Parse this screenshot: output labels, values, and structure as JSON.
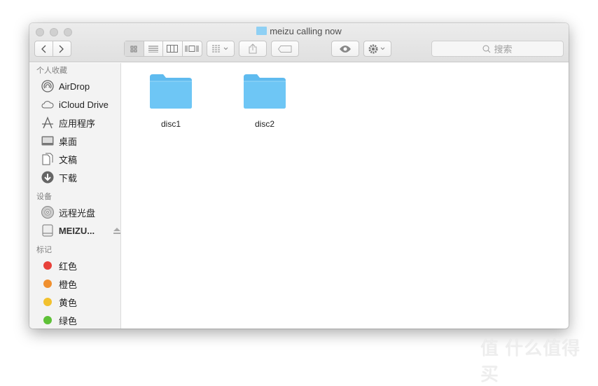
{
  "window": {
    "title": "meizu calling now"
  },
  "toolbar": {
    "search_placeholder": "搜索"
  },
  "sidebar": {
    "favorites_header": "个人收藏",
    "favorites": [
      {
        "label": "AirDrop"
      },
      {
        "label": "iCloud Drive"
      },
      {
        "label": "应用程序"
      },
      {
        "label": "桌面"
      },
      {
        "label": "文稿"
      },
      {
        "label": "下载"
      }
    ],
    "devices_header": "设备",
    "devices": [
      {
        "label": "远程光盘"
      },
      {
        "label": "MEIZU..."
      }
    ],
    "tags_header": "标记",
    "tags": [
      {
        "label": "红色",
        "color": "#e8413a"
      },
      {
        "label": "橙色",
        "color": "#f0902f"
      },
      {
        "label": "黄色",
        "color": "#f2c12e"
      },
      {
        "label": "绿色",
        "color": "#5ec137"
      }
    ]
  },
  "files": [
    {
      "name": "disc1"
    },
    {
      "name": "disc2"
    }
  ],
  "watermark": "值 什么值得买"
}
